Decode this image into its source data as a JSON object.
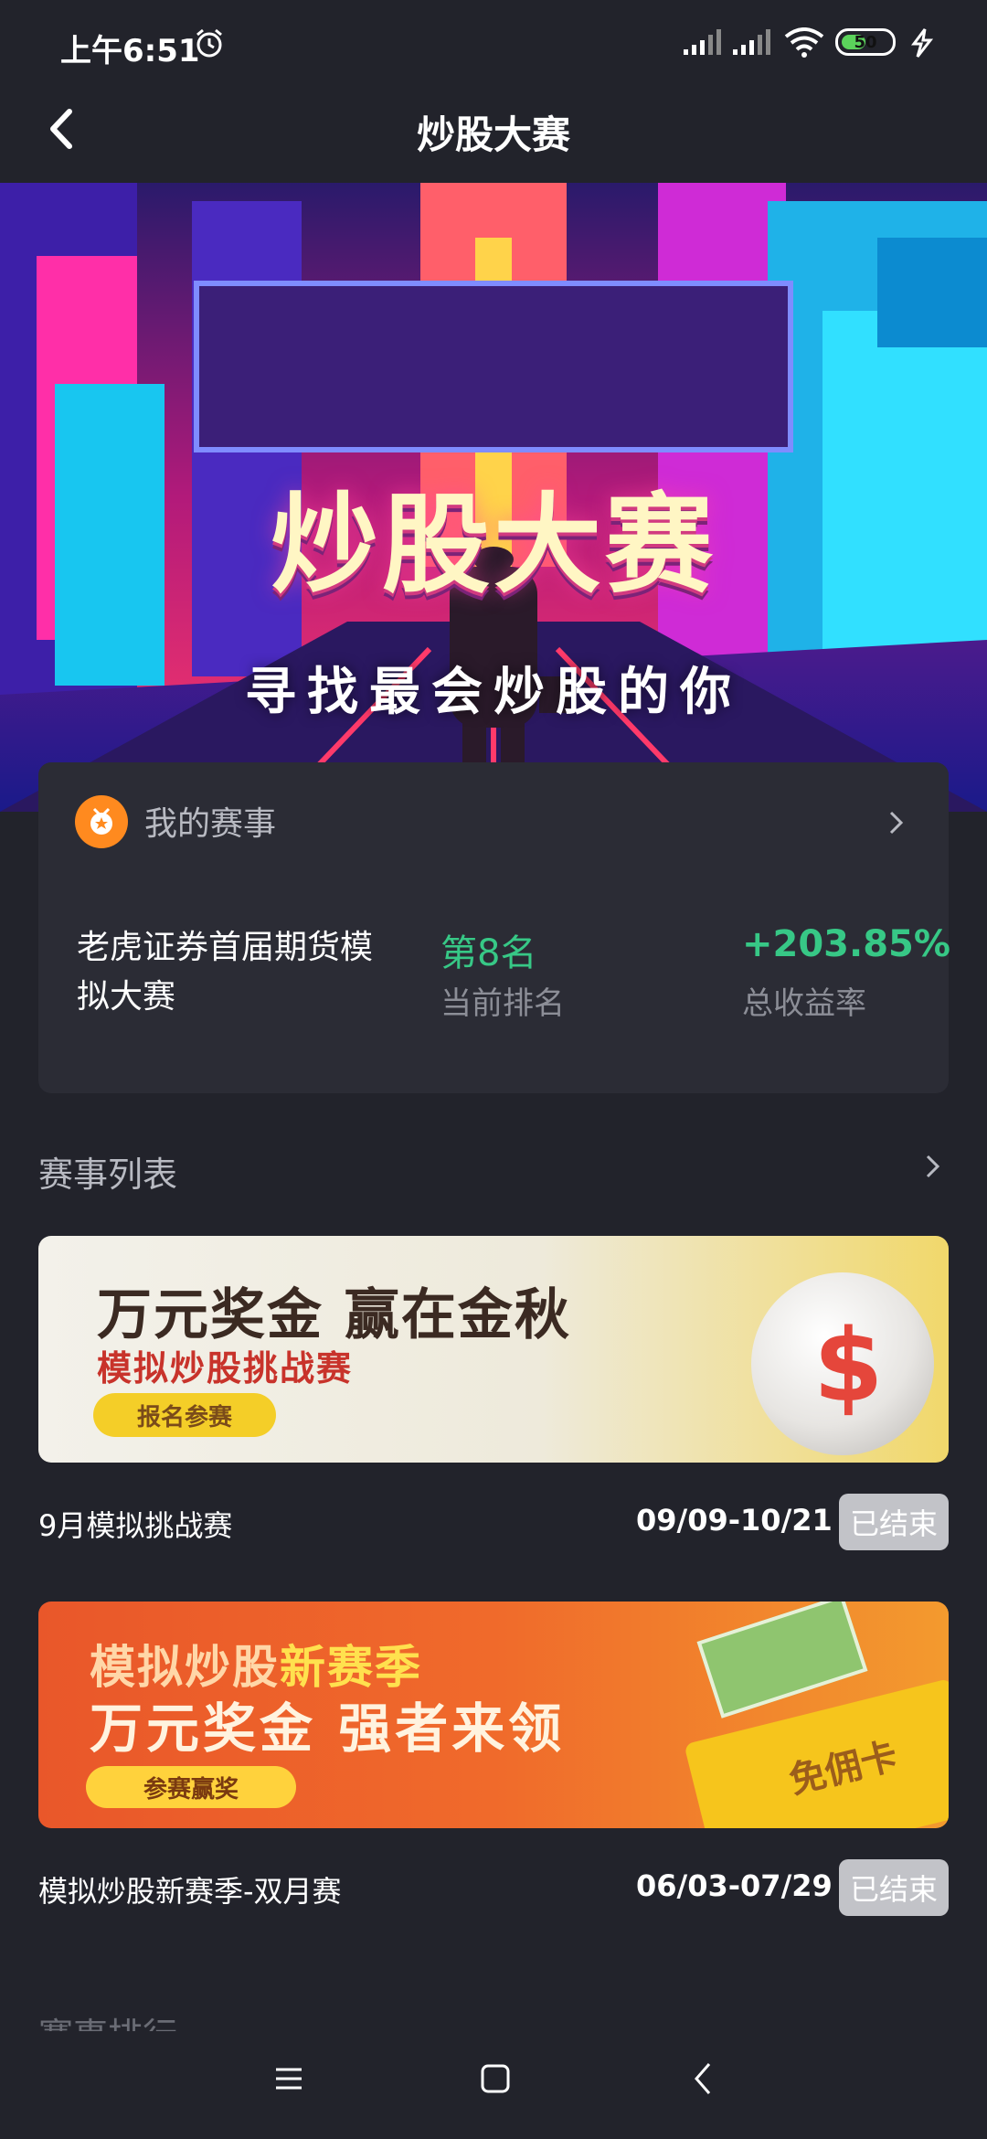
{
  "status_bar": {
    "time": "上午6:51",
    "battery": "50",
    "battery_level": 0.5,
    "icons": [
      "alarm-icon",
      "signal-icon",
      "signal-icon",
      "wifi-icon",
      "battery-icon",
      "charging-icon"
    ]
  },
  "header": {
    "title": "炒股大赛"
  },
  "banner": {
    "title": "炒股大赛",
    "subtitle": "寻找最会炒股的你"
  },
  "my_competition": {
    "title": "我的赛事",
    "competition_name": "老虎证券首届期货模拟大赛",
    "rank_value": "第8名",
    "rank_label": "当前排名",
    "return_value": "+203.85%",
    "return_label": "总收益率"
  },
  "list": {
    "title": "赛事列表",
    "items": [
      {
        "name": "9月模拟挑战赛",
        "dates": "09/09-10/21",
        "status": "已结束",
        "image": {
          "headline": "万元奖金 赢在金秋",
          "subline": "模拟炒股挑战赛",
          "button": "报名参赛",
          "symbol": "$"
        }
      },
      {
        "name": "模拟炒股新赛季-双月赛",
        "dates": "06/03-07/29",
        "status": "已结束",
        "image": {
          "headline_a": "模拟炒股",
          "headline_b": "新赛季",
          "subline": "万元奖金 强者来领",
          "button": "参赛赢奖",
          "card": "免佣卡"
        }
      }
    ]
  },
  "next_section": "赛事排行",
  "colors": {
    "background": "#22232b",
    "card": "#2b2c35",
    "positive": "#37c886",
    "medal": "#ff8a1f",
    "badge": "#c2c3c8"
  }
}
